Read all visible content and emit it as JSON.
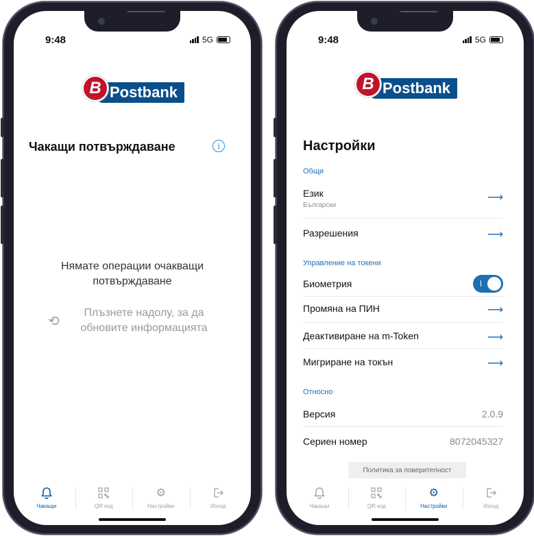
{
  "status_bar": {
    "time": "9:48",
    "network": "5G"
  },
  "brand": {
    "logo_letter": "B",
    "name": "Postbank",
    "color_blue": "#0b4f8a",
    "color_red": "#c0142b"
  },
  "pending_screen": {
    "title": "Чакащи потвърждаване",
    "info_icon": "info-icon",
    "empty_message": "Нямате операции очакващи потвърждаване",
    "pull_message": "Плъзнете надолу, за да обновите информацията"
  },
  "settings_screen": {
    "title": "Настройки",
    "sections": {
      "general": "Общи",
      "tokens": "Управление на токени",
      "about": "Относно"
    },
    "language": {
      "label": "Език",
      "value": "Български"
    },
    "permissions": {
      "label": "Разрешения"
    },
    "biometrics": {
      "label": "Биометрия",
      "enabled": true
    },
    "change_pin": {
      "label": "Промяна на ПИН"
    },
    "deactivate": {
      "label": "Деактивиране на m-Token"
    },
    "migrate": {
      "label": "Мигриране на токън"
    },
    "version": {
      "label": "Версия",
      "value": "2.0.9"
    },
    "serial": {
      "label": "Сериен номер",
      "value": "8072045327"
    },
    "privacy_button": "Политика за поверителност"
  },
  "tabbar": {
    "pending": "Чакащи",
    "qr": "QR код",
    "settings": "Настройки",
    "logout": "Изход"
  },
  "accent_color": "#1f6fb2"
}
